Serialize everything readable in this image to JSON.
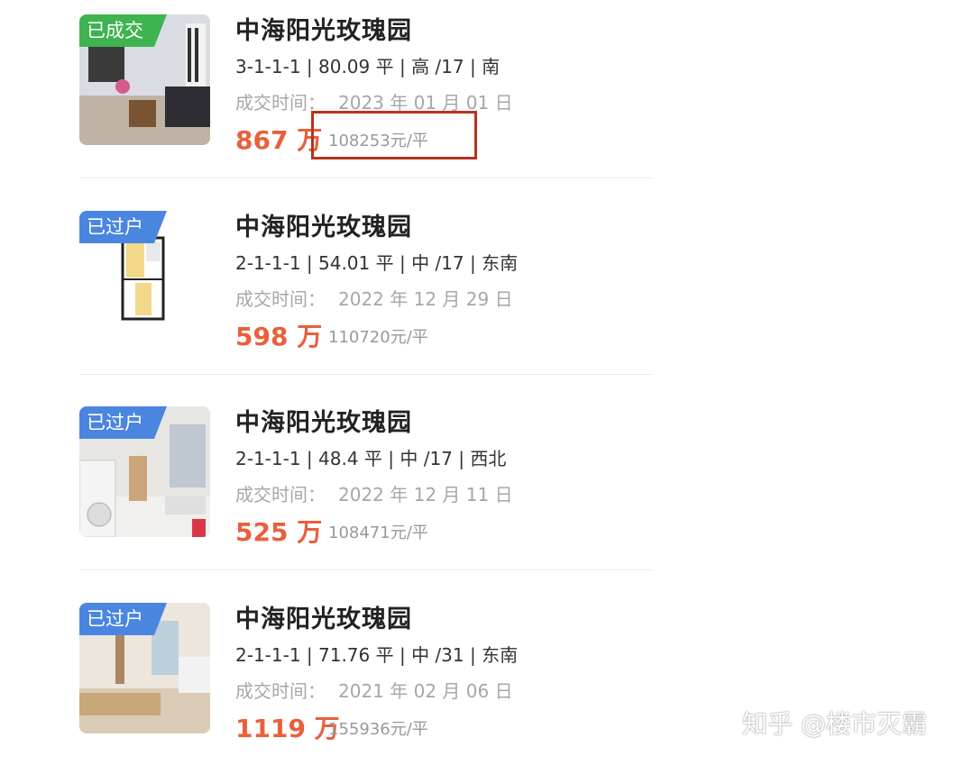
{
  "listings": [
    {
      "badge": "已成交",
      "title": "中海阳光玫瑰园",
      "spec": "3-1-1-1 | 80.09 平 | 高 /17 | 南",
      "date_label": "成交时间：",
      "date": "2023 年 01 月 01 日",
      "price": "867 万",
      "unit_price": "108253元/平"
    },
    {
      "badge": "已过户",
      "title": "中海阳光玫瑰园",
      "spec": "2-1-1-1 | 54.01 平 | 中 /17 | 东南",
      "date_label": "成交时间：",
      "date": "2022 年 12 月 29 日",
      "price": "598 万",
      "unit_price": "110720元/平"
    },
    {
      "badge": "已过户",
      "title": "中海阳光玫瑰园",
      "spec": "2-1-1-1 | 48.4 平 | 中 /17 | 西北",
      "date_label": "成交时间：",
      "date": "2022 年 12 月 11 日",
      "price": "525 万",
      "unit_price": "108471元/平"
    },
    {
      "badge": "已过户",
      "title": "中海阳光玫瑰园",
      "spec": "2-1-1-1 | 71.76 平 | 中 /31 | 东南",
      "date_label": "成交时间：",
      "date": "2021 年 02 月 06 日",
      "price": "1119 万",
      "unit_price": "155936元/平"
    }
  ],
  "watermark": "知乎 @楼市灭霸",
  "colors": {
    "price": "#e8603c",
    "badge_sold": "#3fb34f",
    "badge_transferred": "#4a86e0",
    "highlight": "#b8321e"
  }
}
